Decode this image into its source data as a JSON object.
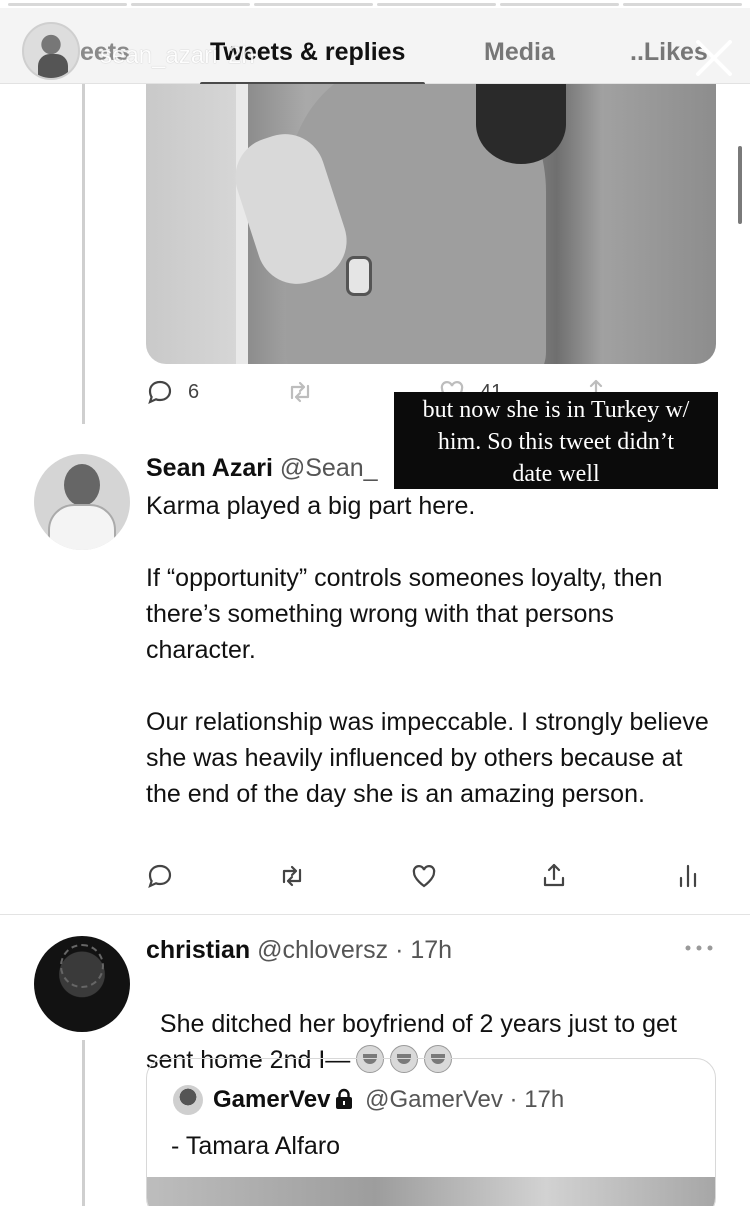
{
  "story": {
    "username": "sean_azari",
    "time": "2h"
  },
  "tabs": {
    "partial": "eets",
    "active": "Tweets & replies",
    "media": "Media",
    "likes": "Likes",
    "likes_prefix": "..",
    "active_underline_color": "#4a4a4a"
  },
  "previous_tweet": {
    "reply_count": "6",
    "like_count": "41"
  },
  "annotation": {
    "text": "but now she is in Turkey w/\nhim. So this tweet didn’t\ndate well"
  },
  "tweet": {
    "name": "Sean Azari",
    "handle": "@Sean_",
    "text": "Karma played a big part here.\n\nIf “opportunity” controls someones loyalty, then there’s something wrong with that persons character.\n\nOur relationship was impeccable. I strongly believe she was heavily influenced by others because at the end of the day she is an amazing person."
  },
  "reply": {
    "name": "christian",
    "handle": "@chloversz",
    "separator": "·",
    "time": "17h",
    "text": "She ditched her boyfriend of 2 years just to get sent home 2nd I—",
    "emoji_count": 3
  },
  "quote": {
    "name": "GamerVev",
    "handle": "@GamerVev",
    "separator": "·",
    "time": "17h",
    "text": "- Tamara Alfaro"
  },
  "icons": {
    "reply": "reply-icon",
    "retweet": "retweet-icon",
    "like": "heart-icon",
    "share": "share-icon",
    "analytics": "analytics-icon",
    "close": "close-icon",
    "more": "more-icon",
    "lock": "lock-icon"
  }
}
